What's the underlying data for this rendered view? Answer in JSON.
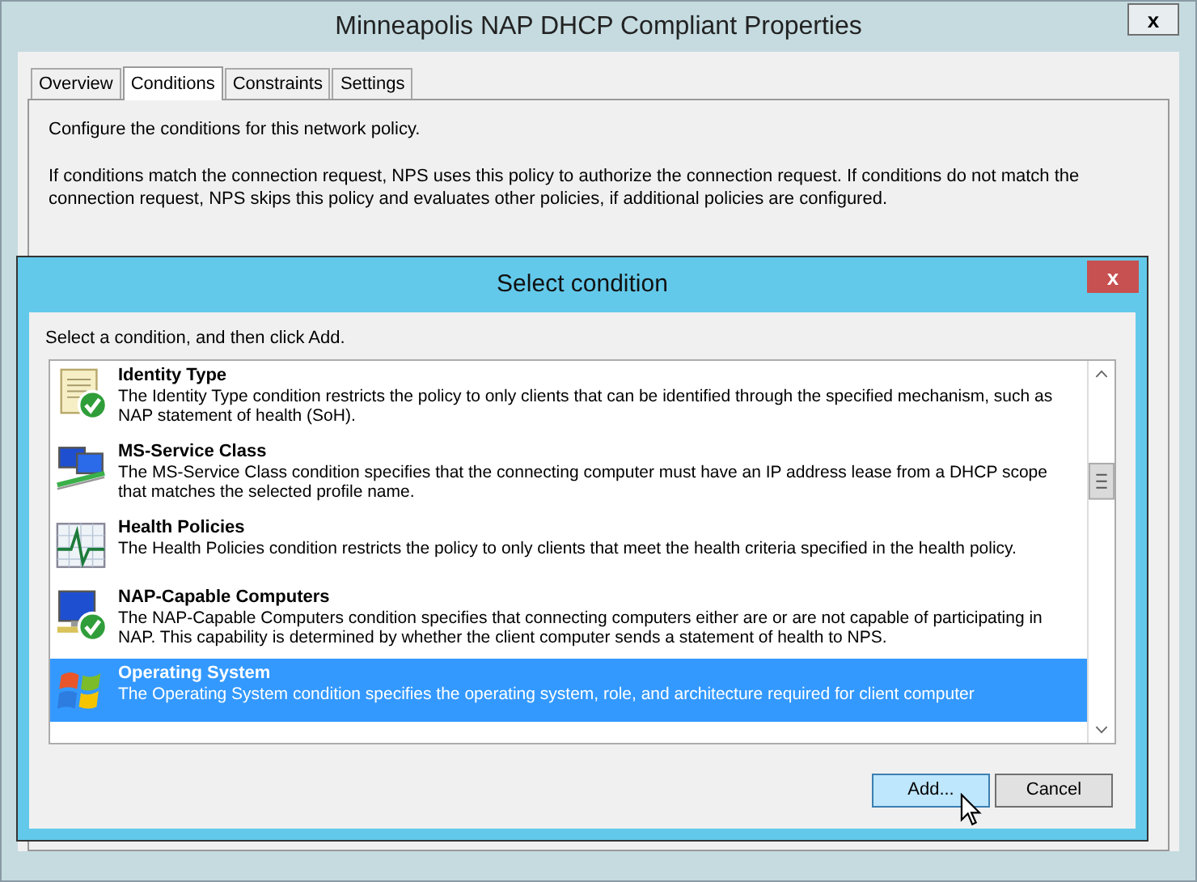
{
  "window": {
    "title": "Minneapolis NAP DHCP Compliant Properties",
    "close": "x"
  },
  "tabs": [
    {
      "label": "Overview",
      "selected": false
    },
    {
      "label": "Conditions",
      "selected": true
    },
    {
      "label": "Constraints",
      "selected": false
    },
    {
      "label": "Settings",
      "selected": false
    }
  ],
  "intro": "Configure the conditions for this network policy.",
  "explanation": "If conditions match the connection request, NPS uses this policy to authorize the connection request. If conditions do not match the connection request, NPS skips this policy and evaluates other policies, if additional policies are configured.",
  "dialog": {
    "title": "Select condition",
    "close": "x",
    "instruction": "Select a condition, and then click Add.",
    "conditions": [
      {
        "kind": "scroll",
        "name": "Identity Type",
        "description": "The Identity Type condition restricts the policy to only clients that can be identified through the specified mechanism, such as NAP statement of health (SoH).",
        "selected": false
      },
      {
        "kind": "network",
        "name": "MS-Service Class",
        "description": "The MS-Service Class condition specifies that the connecting computer must have an IP address lease from a DHCP scope that matches the selected profile name.",
        "selected": false
      },
      {
        "kind": "chart",
        "name": "Health Policies",
        "description": "The Health Policies condition restricts the policy to only clients that meet the health criteria specified in the health policy.",
        "selected": false
      },
      {
        "kind": "computer",
        "name": "NAP-Capable Computers",
        "description": "The NAP-Capable Computers condition specifies that connecting computers either are or are not capable of participating in NAP. This capability is determined by whether the client computer sends a statement of health to NPS.",
        "selected": false
      },
      {
        "kind": "windows",
        "name": "Operating System",
        "description": "The Operating System condition specifies the operating system, role, and architecture required for client computer",
        "selected": true
      }
    ],
    "buttons": [
      {
        "label": "Add...",
        "selected": true
      },
      {
        "label": "Cancel",
        "selected": false
      }
    ]
  }
}
